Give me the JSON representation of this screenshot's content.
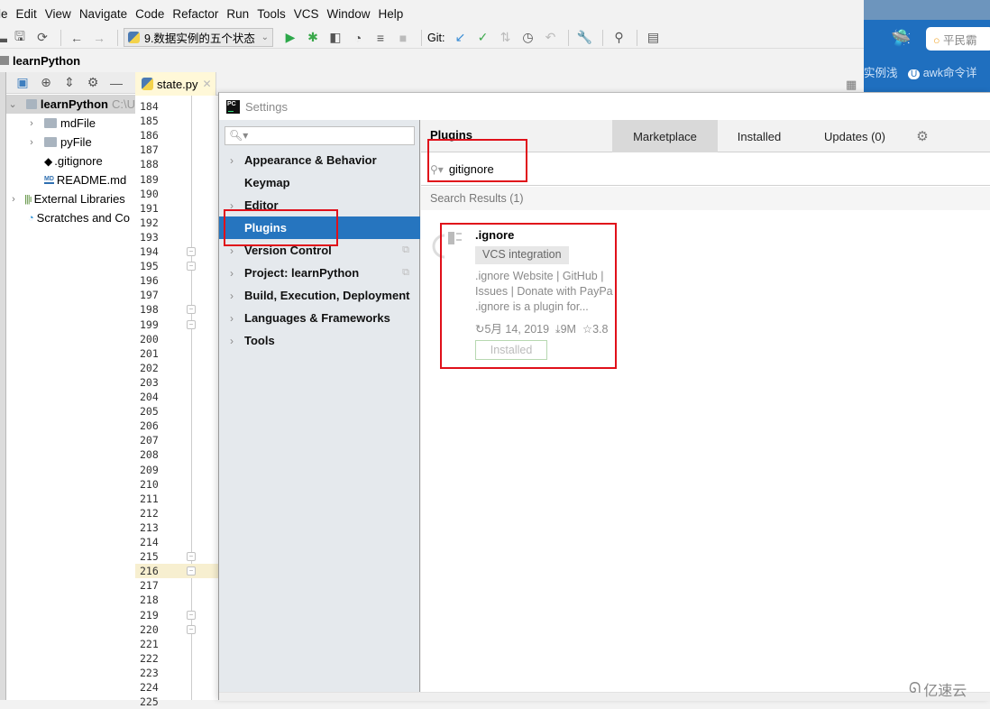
{
  "menu": [
    "le",
    "Edit",
    "View",
    "Navigate",
    "Code",
    "Refactor",
    "Run",
    "Tools",
    "VCS",
    "Window",
    "Help"
  ],
  "toolbar": {
    "run_config": "9.数据实例的五个状态",
    "git_label": "Git:"
  },
  "browser": {
    "search_text": "平民霸",
    "link1": "实例浅",
    "link2": "awk命令详"
  },
  "project": {
    "title": "learnPython",
    "root_name": "learnPython",
    "root_path": "C:\\U",
    "items": [
      {
        "label": "mdFile",
        "type": "folder"
      },
      {
        "label": "pyFile",
        "type": "folder"
      },
      {
        "label": ".gitignore",
        "type": "git-file"
      },
      {
        "label": "README.md",
        "type": "md-file"
      },
      {
        "label": "External Libraries",
        "type": "libraries"
      },
      {
        "label": "Scratches and Co",
        "type": "scratches"
      }
    ]
  },
  "editor": {
    "tab_label": "state.py",
    "line_start": 184,
    "line_end": 225,
    "highlighted_line": 216,
    "fold_markers": [
      194,
      195,
      198,
      199,
      215,
      216,
      219,
      220
    ]
  },
  "settings": {
    "title": "Settings",
    "search_placeholder": "",
    "nav": [
      {
        "label": "Appearance & Behavior",
        "chevron": true,
        "copy": false
      },
      {
        "label": "Keymap",
        "chevron": false,
        "copy": false
      },
      {
        "label": "Editor",
        "chevron": true,
        "copy": false
      },
      {
        "label": "Plugins",
        "chevron": false,
        "copy": false,
        "selected": true
      },
      {
        "label": "Version Control",
        "chevron": true,
        "copy": true
      },
      {
        "label": "Project: learnPython",
        "chevron": true,
        "copy": true
      },
      {
        "label": "Build, Execution, Deployment",
        "chevron": true,
        "copy": false
      },
      {
        "label": "Languages & Frameworks",
        "chevron": true,
        "copy": false
      },
      {
        "label": "Tools",
        "chevron": true,
        "copy": false
      }
    ],
    "plugins": {
      "header": "Plugins",
      "tabs": [
        "Marketplace",
        "Installed",
        "Updates (0)"
      ],
      "active_tab": "Marketplace",
      "search_value": "gitignore",
      "results_label": "Search Results (1)",
      "result": {
        "name": ".ignore",
        "tag": "VCS integration",
        "desc_lines": [
          ".ignore Website | GitHub |",
          "Issues | Donate with PayPa",
          ".ignore is a plugin for..."
        ],
        "date": "5月 14, 2019",
        "downloads": "9M",
        "rating": "3.8",
        "button": "Installed"
      }
    }
  },
  "watermark": "亿速云",
  "colors": {
    "selection": "#2675bf",
    "annotation_red": "#e0101a",
    "line_highlight": "#f7efd0"
  }
}
